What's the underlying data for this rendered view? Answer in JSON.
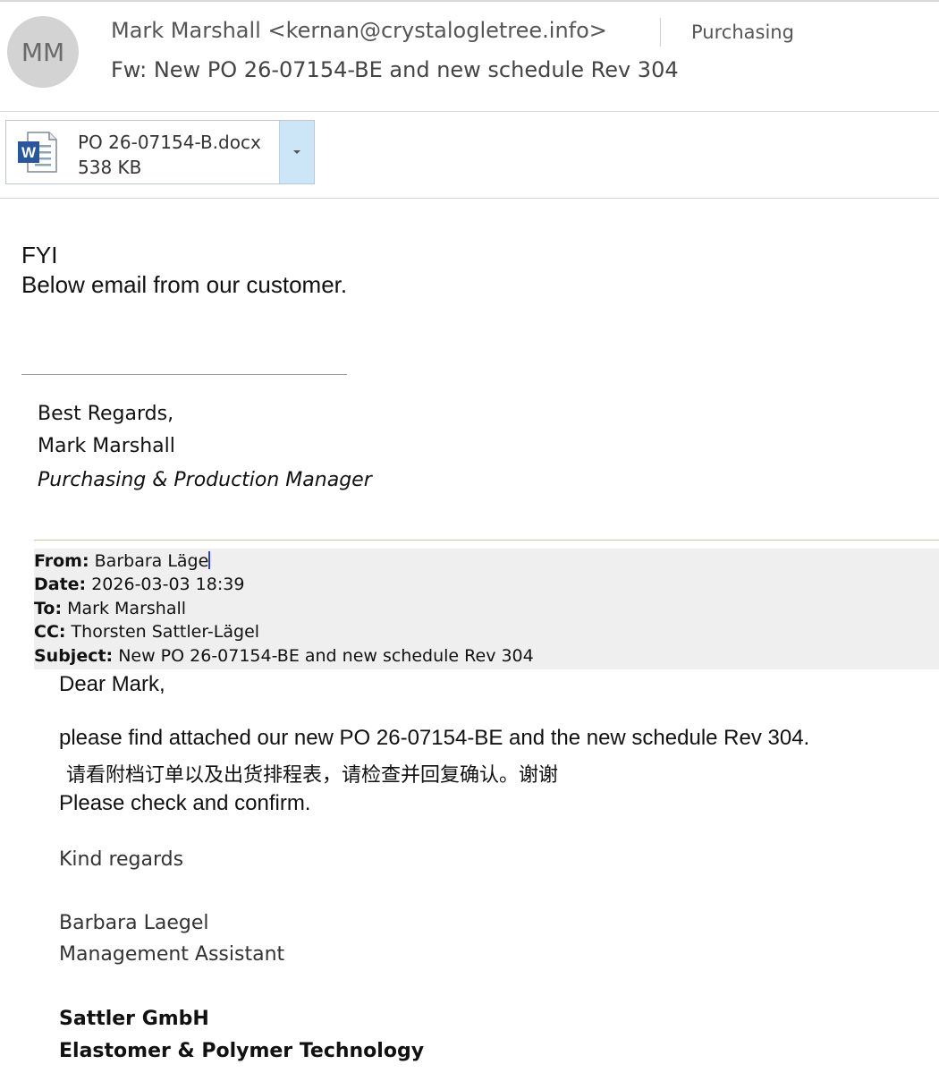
{
  "header": {
    "avatar_initials": "MM",
    "sender": "Mark Marshall <kernan@crystalogletree.info>",
    "category": "Purchasing",
    "subject": "Fw: New PO 26-07154-BE and new schedule Rev 304"
  },
  "attachment": {
    "icon": "word-document-icon",
    "icon_letter": "W",
    "name": "PO 26-07154-B.docx",
    "size": "538 KB",
    "dropdown_icon": "chevron-down-icon"
  },
  "body": {
    "line1": "FYI",
    "line2": "Below email from our customer."
  },
  "signature": {
    "closing": "Best Regards,",
    "name": "Mark Marshall",
    "title": "Purchasing & Production Manager"
  },
  "forwarded": {
    "from_label": "From:",
    "from_value": "Barbara Läge",
    "date_label": "Date:",
    "date_value": "2026-03-03 18:39",
    "to_label": "To:",
    "to_value": "Mark Marshall",
    "cc_label": "CC:",
    "cc_value": "Thorsten Sattler-Lägel",
    "subject_label": "Subject:",
    "subject_value": "New PO 26-07154-BE and new schedule Rev 304"
  },
  "message": {
    "greeting": "Dear Mark,",
    "para1": "please find attached our new PO 26-07154-BE and the new schedule Rev 304.",
    "para_cn": "请看附档订单以及出货排程表，请检查并回复确认。谢谢",
    "para2": "Please check and confirm.",
    "closing": "Kind regards",
    "sender_name": "Barbara Laegel",
    "sender_title": "Management Assistant",
    "company": "Sattler GmbH",
    "company_tagline": "Elastomer & Polymer Technology"
  },
  "colors": {
    "avatar_bg": "#d3d3d3",
    "attachment_dropdown_bg": "#cde6f7",
    "word_blue": "#2b579a",
    "forward_header_bg": "#efefef"
  }
}
